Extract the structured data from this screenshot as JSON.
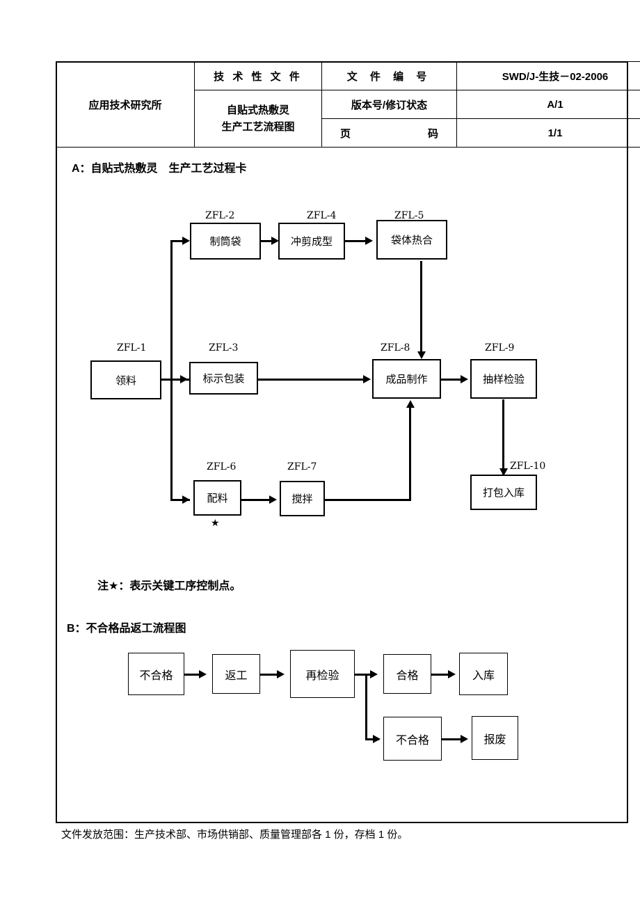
{
  "header": {
    "organization": "应用技术研究所",
    "doc_type_label": "技 术 性 文 件",
    "doc_name_line1": "自贴式热敷灵",
    "doc_name_line2": "生产工艺流程图",
    "doc_number_label": "文 件 编 号",
    "doc_number_value": "SWD/J-生技－02-2006",
    "version_label": "版本号/修订状态",
    "version_value": "A/1",
    "page_label_left": "页",
    "page_label_right": "码",
    "page_value": "1/1"
  },
  "section_a": {
    "title": "A：自贴式热敷灵　生产工艺过程卡",
    "note": "注★：表示关键工序控制点。",
    "nodes": [
      {
        "tag": "ZFL-1",
        "label": "领料"
      },
      {
        "tag": "ZFL-2",
        "label": "制筒袋"
      },
      {
        "tag": "ZFL-3",
        "label": "标示包装"
      },
      {
        "tag": "ZFL-4",
        "label": "冲剪成型"
      },
      {
        "tag": "ZFL-5",
        "label": "袋体热合"
      },
      {
        "tag": "ZFL-6",
        "label": "配料"
      },
      {
        "tag": "ZFL-7",
        "label": "搅拌"
      },
      {
        "tag": "ZFL-8",
        "label": "成品制作"
      },
      {
        "tag": "ZFL-9",
        "label": "抽样检验"
      },
      {
        "tag": "ZFL-10",
        "label": "打包入库"
      }
    ],
    "key_control_marker": "★"
  },
  "section_b": {
    "title": "B：不合格品返工流程图",
    "nodes": [
      {
        "label": "不合格"
      },
      {
        "label": "返工"
      },
      {
        "label": "再检验"
      },
      {
        "label": "合格"
      },
      {
        "label": "入库"
      },
      {
        "label": "不合格"
      },
      {
        "label": "报废"
      }
    ]
  },
  "footer": {
    "distribution": "文件发放范围：生产技术部、市场供销部、质量管理部各 1 份，存档 1 份。"
  }
}
